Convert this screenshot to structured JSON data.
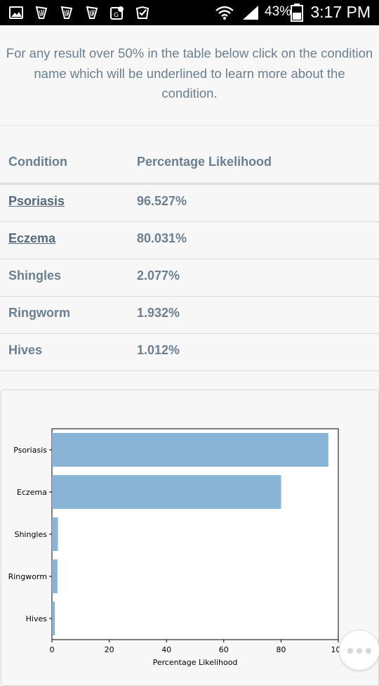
{
  "status_bar": {
    "battery_percent": "43%",
    "time": "3:17 PM",
    "icons": [
      "image-icon",
      "harp-icon",
      "harp-icon",
      "harp-icon",
      "maps-icon",
      "check-icon",
      "wifi-icon",
      "signal-icon",
      "battery-icon"
    ]
  },
  "intro": {
    "text": "For any result over 50% in the table below click on the condition name which will be underlined to learn more about the condition."
  },
  "table": {
    "headers": [
      "Condition",
      "Percentage Likelihood"
    ],
    "rows": [
      {
        "condition": "Psoriasis",
        "likelihood": "96.527%",
        "link": true
      },
      {
        "condition": "Eczema",
        "likelihood": "80.031%",
        "link": true
      },
      {
        "condition": "Shingles",
        "likelihood": "2.077%",
        "link": false
      },
      {
        "condition": "Ringworm",
        "likelihood": "1.932%",
        "link": false
      },
      {
        "condition": "Hives",
        "likelihood": "1.012%",
        "link": false
      }
    ]
  },
  "chart_data": {
    "type": "bar",
    "orientation": "horizontal",
    "categories": [
      "Psoriasis",
      "Eczema",
      "Shingles",
      "Ringworm",
      "Hives"
    ],
    "values": [
      96.527,
      80.031,
      2.077,
      1.932,
      1.012
    ],
    "xlabel": "Percentage Likelihood",
    "ylabel": "",
    "xlim": [
      0,
      100
    ],
    "xticks": [
      0,
      20,
      40,
      60,
      80,
      100
    ],
    "grid": false,
    "bar_color": "#8ab4d5"
  }
}
